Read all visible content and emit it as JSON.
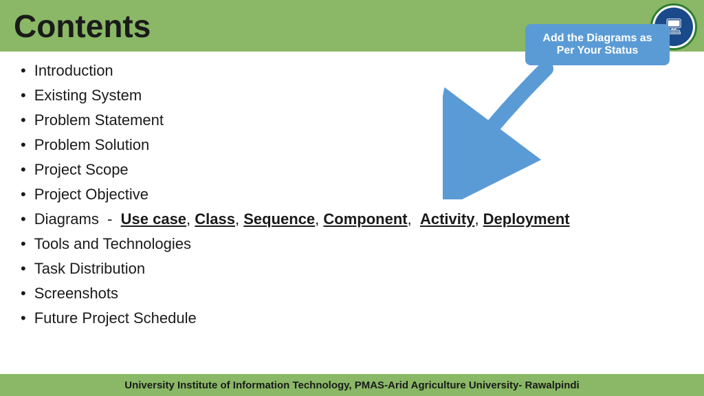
{
  "header": {
    "title": "Contents"
  },
  "list": {
    "items": [
      {
        "id": "introduction",
        "text": "Introduction",
        "type": "plain"
      },
      {
        "id": "existing-system",
        "text": "Existing System",
        "type": "plain"
      },
      {
        "id": "problem-statement",
        "text": "Problem Statement",
        "type": "plain"
      },
      {
        "id": "problem-solution",
        "text": "Problem Solution",
        "type": "plain"
      },
      {
        "id": "project-scope",
        "text": "Project Scope",
        "type": "plain"
      },
      {
        "id": "project-objective",
        "text": "Project Objective",
        "type": "plain"
      },
      {
        "id": "diagrams",
        "text": "Diagrams  - ",
        "type": "diagrams",
        "links": [
          "Use case",
          "Class",
          "Sequence",
          "Component",
          "Activity",
          "Deployment"
        ]
      },
      {
        "id": "tools",
        "text": "Tools and Technologies",
        "type": "plain"
      },
      {
        "id": "task-distribution",
        "text": "Task Distribution",
        "type": "plain"
      },
      {
        "id": "screenshots",
        "text": "Screenshots",
        "type": "plain"
      },
      {
        "id": "future-schedule",
        "text": "Future Project Schedule",
        "type": "plain"
      }
    ]
  },
  "callout": {
    "text": "Add the Diagrams as Per Your Status"
  },
  "footer": {
    "text": "University Institute of Information Technology,  PMAS-Arid Agriculture University- Rawalpindi"
  }
}
